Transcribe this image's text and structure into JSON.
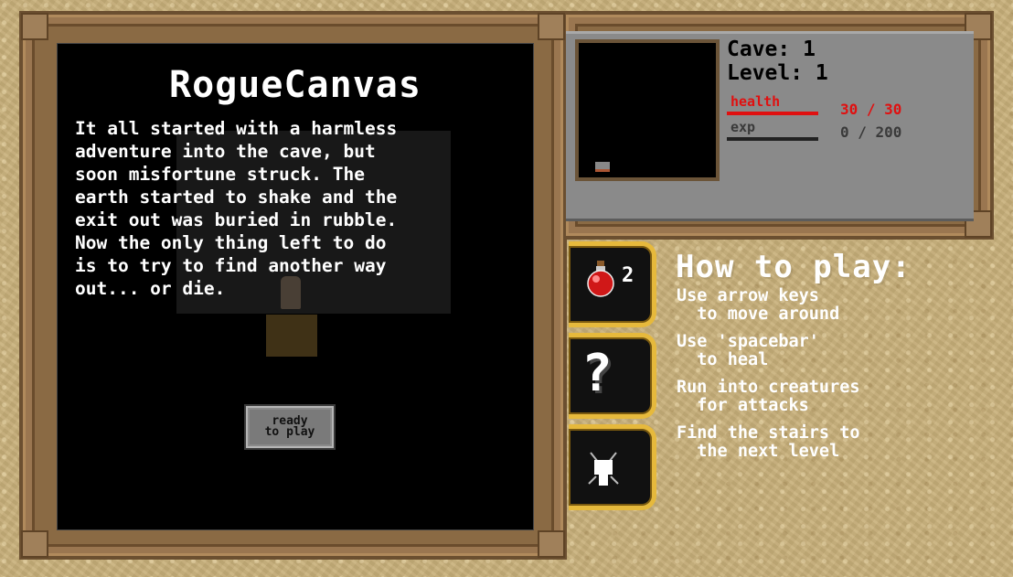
{
  "game": {
    "title": "RogueCanvas",
    "intro": "It all started with a harmless\nadventure into the cave, but\nsoon misfortune struck. The\nearth started to shake and the\nexit out was buried in rubble.\nNow the only thing left to do\nis to try to find another way\nout... or die.",
    "ready_button": "ready\nto play"
  },
  "status": {
    "cave_line": "Cave: 1",
    "level_line": "Level: 1",
    "health_label": "health",
    "health_value": "30 / 30",
    "health_fraction": 1.0,
    "exp_label": "exp",
    "exp_value": "0 / 200",
    "exp_fraction": 0.0
  },
  "inventory": {
    "potion_count": "2",
    "help_glyph": "?"
  },
  "howto": {
    "title": "How to play:",
    "items": [
      "Use arrow keys\n  to move around",
      "Use 'spacebar'\n  to heal",
      "Run into creatures\n  for attacks",
      "Find the stairs to\n  the next level"
    ]
  },
  "colors": {
    "health": "#e01010",
    "tab_border": "#e6b93c",
    "frame_wood": "#8a6a44",
    "parchment": "#c8b07a"
  },
  "icons": [
    "potion-icon",
    "help-icon",
    "settings-icon",
    "minimap-player-icon"
  ]
}
